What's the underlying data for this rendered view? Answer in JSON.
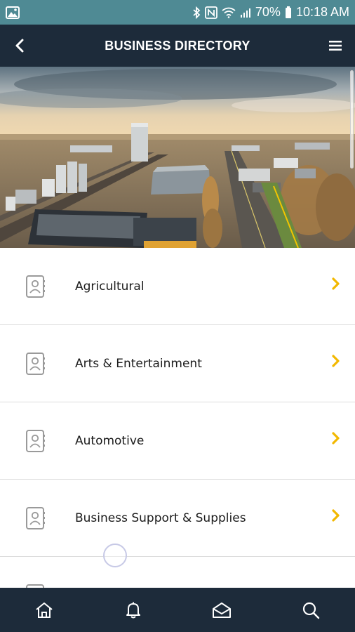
{
  "status_bar": {
    "battery": "70%",
    "time": "10:18 AM",
    "icons": [
      "image-icon",
      "bluetooth-icon",
      "nfc-icon",
      "wifi-icon",
      "signal-icon",
      "battery-icon"
    ]
  },
  "header": {
    "title": "BUSINESS DIRECTORY",
    "back_icon": "chevron-left-icon",
    "menu_icon": "hamburger-menu-icon"
  },
  "hero": {
    "description_icon": "town-aerial-photo"
  },
  "categories": [
    {
      "label": "Agricultural",
      "icon": "contact-book-icon"
    },
    {
      "label": "Arts & Entertainment",
      "icon": "contact-book-icon"
    },
    {
      "label": "Automotive",
      "icon": "contact-book-icon"
    },
    {
      "label": "Business Support & Supplies",
      "icon": "contact-book-icon"
    }
  ],
  "bottom_nav": [
    {
      "name": "home",
      "icon": "home-icon"
    },
    {
      "name": "notifications",
      "icon": "bell-icon"
    },
    {
      "name": "messages",
      "icon": "envelope-open-icon"
    },
    {
      "name": "search",
      "icon": "search-icon"
    }
  ],
  "colors": {
    "status_bar": "#4f8a94",
    "header": "#1d2b3a",
    "accent_chevron": "#f2b800",
    "divider": "#dcdcdc"
  }
}
